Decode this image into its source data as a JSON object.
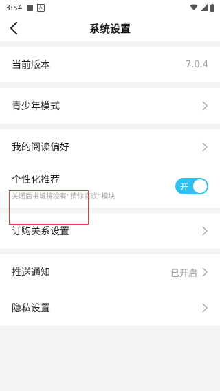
{
  "status_bar": {
    "time": "3:54"
  },
  "header": {
    "title": "系统设置"
  },
  "rows": {
    "version": {
      "label": "当前版本",
      "value": "7.0.4"
    },
    "youth": {
      "label": "青少年模式"
    },
    "reading": {
      "label": "我的阅读偏好"
    },
    "recommend": {
      "label": "个性化推荐",
      "sub": "关闭后书城将没有“猜你喜欢”模块",
      "toggle_label": "开",
      "toggle_on": true
    },
    "subscribe": {
      "label": "订购关系设置"
    },
    "push": {
      "label": "推送通知",
      "value": "已开启"
    },
    "privacy": {
      "label": "隐私设置"
    }
  },
  "colors": {
    "accent": "#2fc1f0",
    "highlight": "#e0383e"
  }
}
